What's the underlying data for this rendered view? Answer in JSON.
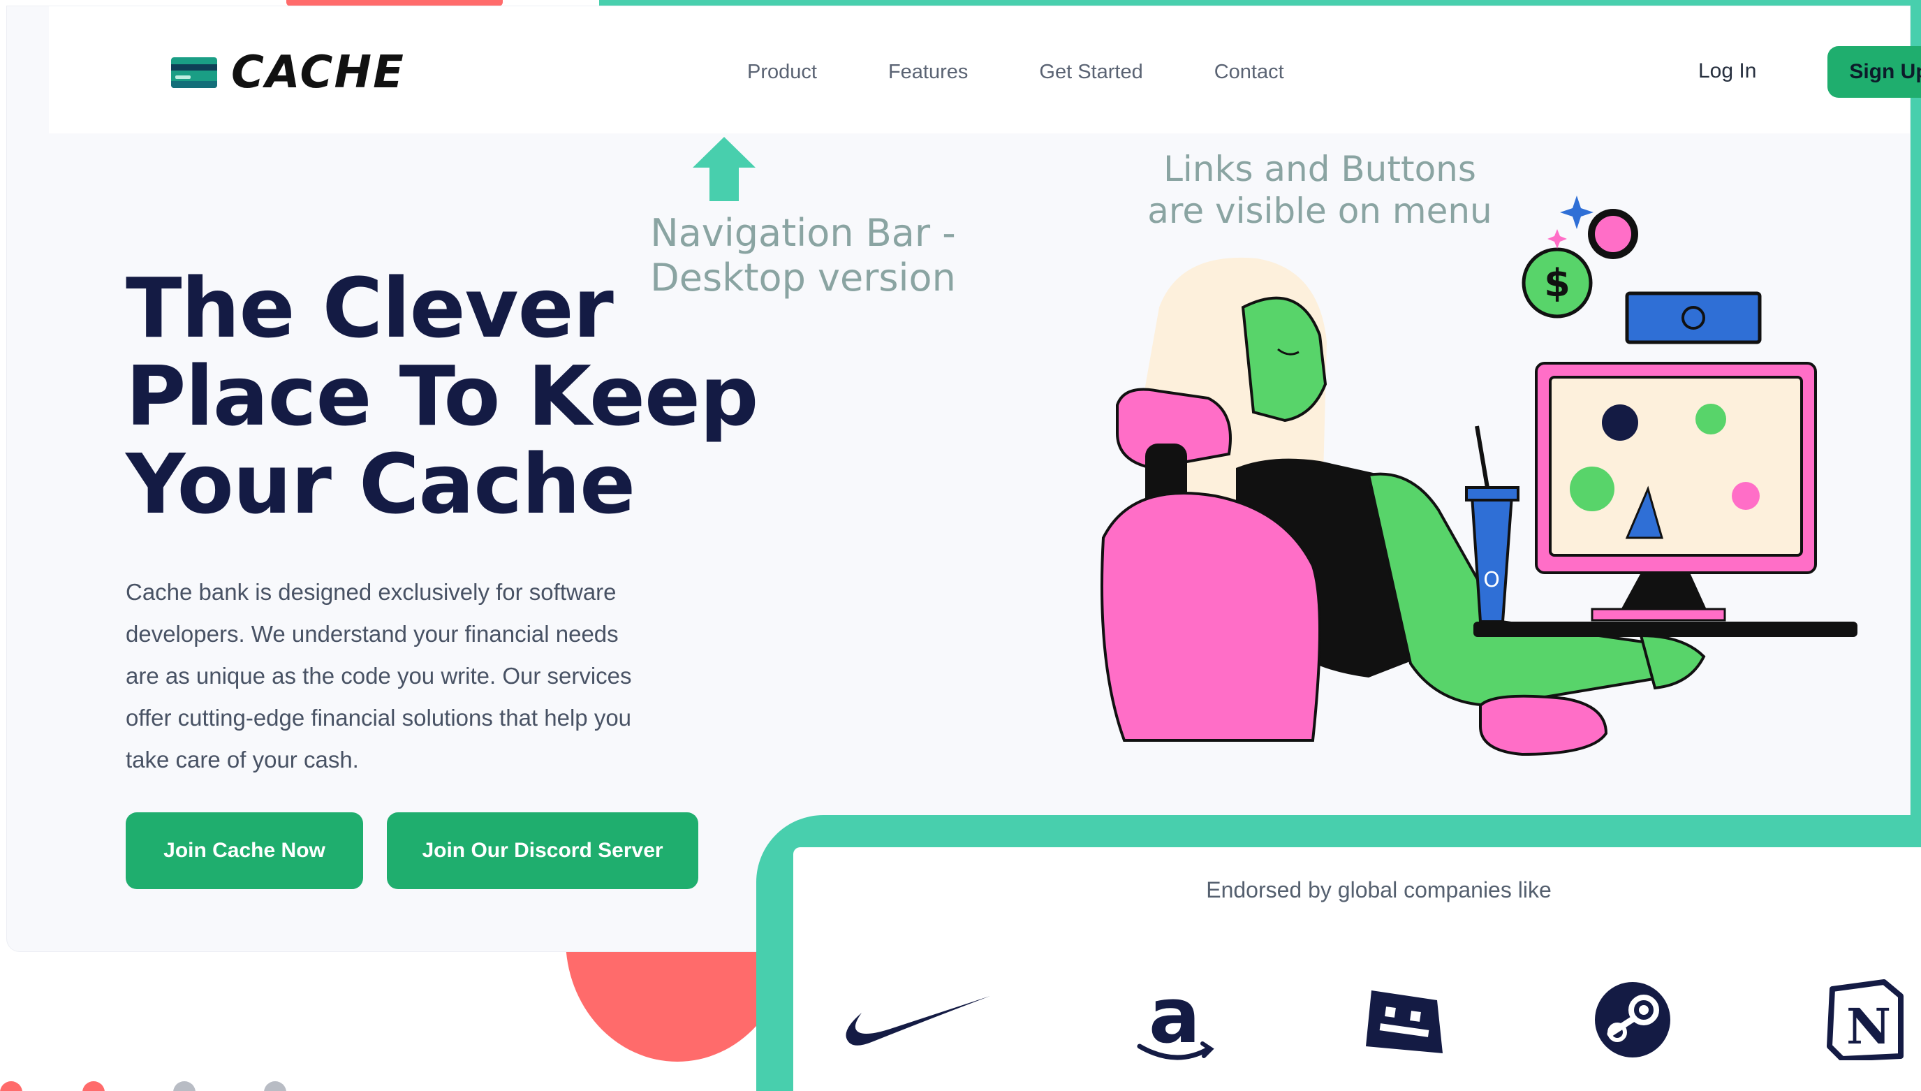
{
  "nav": {
    "logo_text": "CACHE",
    "links": [
      "Product",
      "Features",
      "Get Started",
      "Contact"
    ],
    "login": "Log In",
    "signup": "Sign Up"
  },
  "annotations": {
    "nav_note": "Navigation Bar - Desktop version",
    "links_note": "Links and Buttons are visible on menu"
  },
  "hero": {
    "headline": "The Clever Place To Keep Your Cache",
    "description": "Cache bank is designed exclusively for software developers. We understand your financial needs are as unique as the code you write. Our services offer cutting-edge financial solutions that help you take care of your cash.",
    "primary_button": "Join Cache Now",
    "secondary_button": "Join Our Discord Server"
  },
  "endorsements": {
    "title": "Endorsed by global companies like",
    "brand_icons": [
      "nike-logo-icon",
      "amazon-logo-icon",
      "roblox-logo-icon",
      "steam-logo-icon",
      "notion-logo-icon"
    ]
  },
  "colors": {
    "accent_green": "#1fae6e",
    "teal": "#48cfad",
    "coral": "#ff6b6b",
    "navy": "#141b44",
    "pink": "#ff6ec7",
    "figure_green": "#58d46a"
  }
}
